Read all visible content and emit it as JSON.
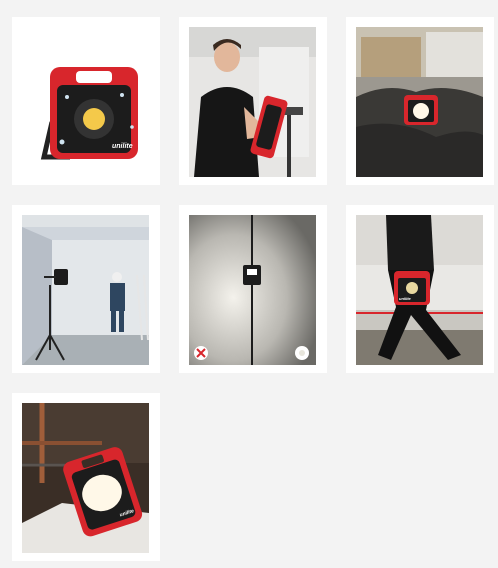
{
  "gallery": {
    "items": [
      {
        "id": 1,
        "subject": "floodlight-product-wet",
        "brand_text": "unilite"
      },
      {
        "id": 2,
        "subject": "man-holding-floodlight"
      },
      {
        "id": 3,
        "subject": "floodlight-on-construction-site"
      },
      {
        "id": 4,
        "subject": "floodlight-on-tripod-in-room"
      },
      {
        "id": 5,
        "subject": "floodlight-beam-dark-room"
      },
      {
        "id": 6,
        "subject": "person-carrying-floodlight",
        "brand_text": "unilite"
      },
      {
        "id": 7,
        "subject": "floodlight-near-pipes",
        "brand_text": "unilite"
      }
    ]
  },
  "colors": {
    "page_bg": "#f3f3f3",
    "card_bg": "#ffffff",
    "accent_red": "#d8262c",
    "product_black": "#1c1c1c",
    "light_white": "#fff8e8"
  },
  "icons": {
    "bad_example": "red-x-circle-icon",
    "good_example": "light-bulb-circle-icon"
  }
}
